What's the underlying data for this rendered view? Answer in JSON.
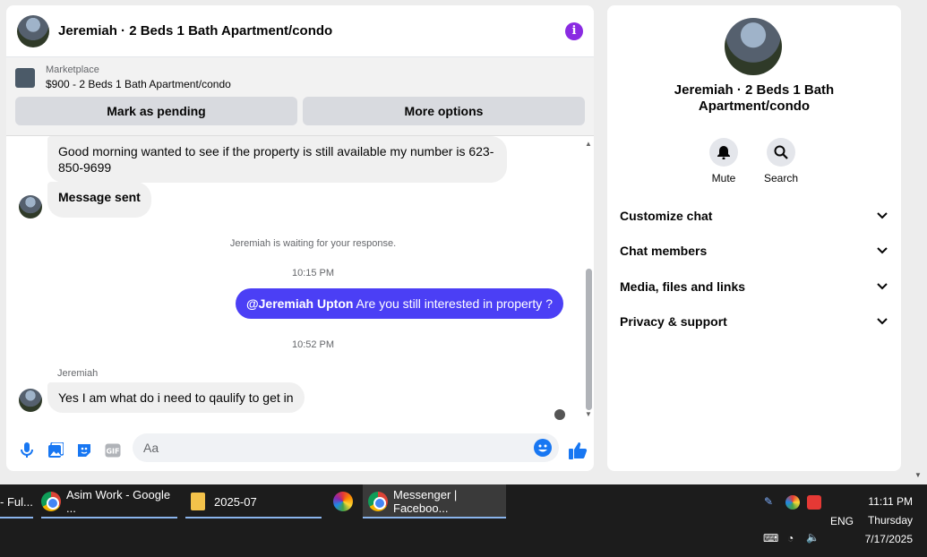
{
  "chat": {
    "header_title": "Jeremiah · 2 Beds 1 Bath Apartment/condo",
    "marketplace_label": "Marketplace",
    "listing_title": "$900 - 2 Beds 1 Bath Apartment/condo",
    "pending_button": "Mark as pending",
    "more_button": "More options",
    "messages": {
      "m1": "Good morning wanted to see if the property is still available my number is 623-850-9699",
      "m2": "Message sent",
      "waiting": "Jeremiah is waiting for your response.",
      "time1": "10:15 PM",
      "out_mention": "@Jeremiah Upton",
      "out_text": "Are you still interested in property ?",
      "time2": "10:52 PM",
      "sender": "Jeremiah",
      "m3": "Yes I am what do i need to qaulify to get in"
    },
    "composer_placeholder": "Aa"
  },
  "info": {
    "title": "Jeremiah · 2 Beds 1 Bath Apartment/condo",
    "mute_label": "Mute",
    "search_label": "Search",
    "sections": [
      "Customize chat",
      "Chat members",
      "Media, files and links",
      "Privacy & support"
    ]
  },
  "taskbar": {
    "item1": "- Ful...",
    "item2": "Asim Work - Google ...",
    "item3": "2025-07",
    "item4": "Messenger | Faceboo...",
    "lang": "ENG",
    "time": "11:11 PM",
    "day": "Thursday",
    "date": "7/17/2025"
  },
  "colors": {
    "accent": "#4b3ff5",
    "messenger_blue": "#1877f2",
    "info_purple": "#8a2be2"
  }
}
